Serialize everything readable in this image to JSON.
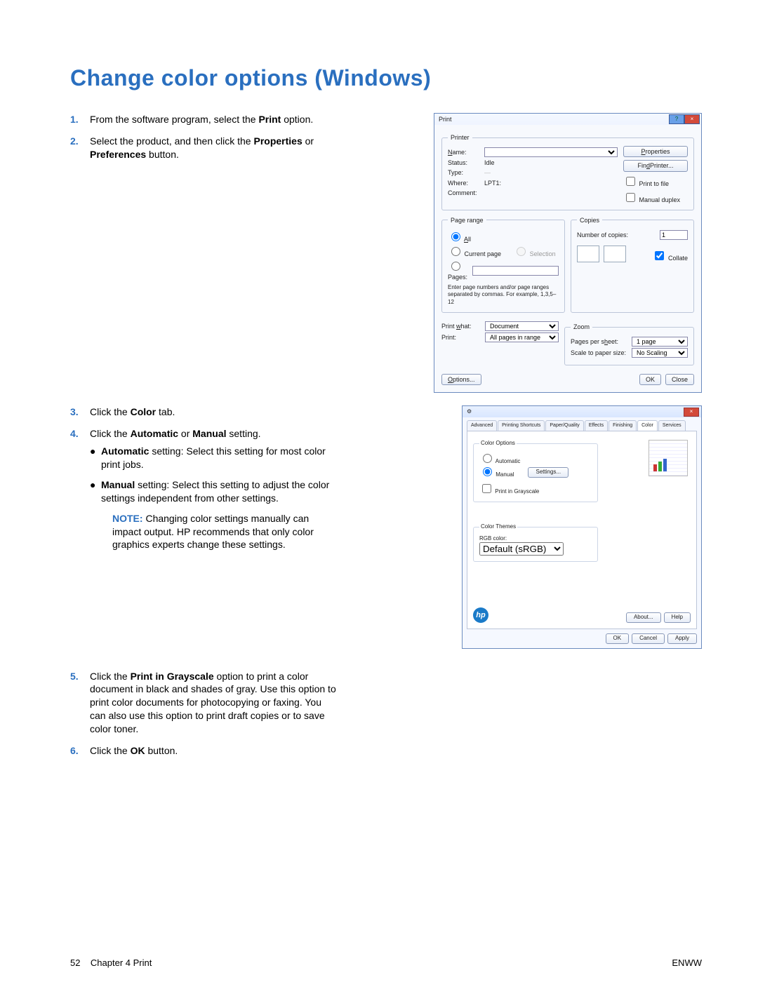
{
  "title": "Change color options (Windows)",
  "steps": {
    "n1": "1.",
    "s1a": "From the software program, select the ",
    "s1b": "Print",
    "s1c": " option.",
    "n2": "2.",
    "s2a": "Select the product, and then click the ",
    "s2b": "Properties",
    "s2c": " or ",
    "s2d": "Preferences",
    "s2e": " button.",
    "n3": "3.",
    "s3a": "Click the ",
    "s3b": "Color",
    "s3c": " tab.",
    "n4": "4.",
    "s4a": "Click the ",
    "s4b": "Automatic",
    "s4c": " or ",
    "s4d": "Manual",
    "s4e": " setting.",
    "b1a": "Automatic",
    "b1b": " setting: Select this setting for most color print jobs.",
    "b2a": "Manual",
    "b2b": " setting: Select this setting to adjust the color settings independent from other settings.",
    "note_label": "NOTE:",
    "note_text": "Changing color settings manually can impact output. HP recommends that only color graphics experts change these settings.",
    "n5": "5.",
    "s5a": "Click the ",
    "s5b": "Print in Grayscale",
    "s5c": " option to print a color document in black and shades of gray. Use this option to print color documents for photocopying or faxing. You can also use this option to print draft copies or to save color toner.",
    "n6": "6.",
    "s6a": "Click the ",
    "s6b": "OK",
    "s6c": " button."
  },
  "print_dialog": {
    "title": "Print",
    "printer_legend": "Printer",
    "name_label": "Name:",
    "status_label": "Status:",
    "status_value": "Idle",
    "type_label": "Type:",
    "where_label": "Where:",
    "where_value": "LPT1:",
    "comment_label": "Comment:",
    "properties_btn": "Properties",
    "find_btn": "Find Printer...",
    "print_to_file": "Print to file",
    "manual_duplex": "Manual duplex",
    "page_range_legend": "Page range",
    "all": "All",
    "current_page": "Current page",
    "selection": "Selection",
    "pages": "Pages:",
    "pages_hint": "Enter page numbers and/or page ranges separated by commas. For example, 1,3,5–12",
    "copies_legend": "Copies",
    "num_copies": "Number of copies:",
    "num_copies_value": "1",
    "collate": "Collate",
    "print_what_label": "Print what:",
    "print_what_value": "Document",
    "print_label": "Print:",
    "print_value": "All pages in range",
    "zoom_legend": "Zoom",
    "pps_label": "Pages per sheet:",
    "pps_value": "1 page",
    "scale_label": "Scale to paper size:",
    "scale_value": "No Scaling",
    "options_btn": "Options...",
    "ok_btn": "OK",
    "close_btn": "Close"
  },
  "prop_dialog": {
    "tabs": {
      "advanced": "Advanced",
      "shortcuts": "Printing Shortcuts",
      "paper": "Paper/Quality",
      "effects": "Effects",
      "finishing": "Finishing",
      "color": "Color",
      "services": "Services"
    },
    "color_options_legend": "Color Options",
    "automatic": "Automatic",
    "manual": "Manual",
    "settings_btn": "Settings...",
    "grayscale": "Print in Grayscale",
    "color_themes_legend": "Color Themes",
    "rgb_label": "RGB color:",
    "rgb_value": "Default (sRGB)",
    "hp": "hp",
    "about_btn": "About...",
    "help_btn": "Help",
    "ok_btn": "OK",
    "cancel_btn": "Cancel",
    "apply_btn": "Apply"
  },
  "footer": {
    "page_num": "52",
    "chapter": "Chapter 4   Print",
    "enww": "ENWW"
  }
}
